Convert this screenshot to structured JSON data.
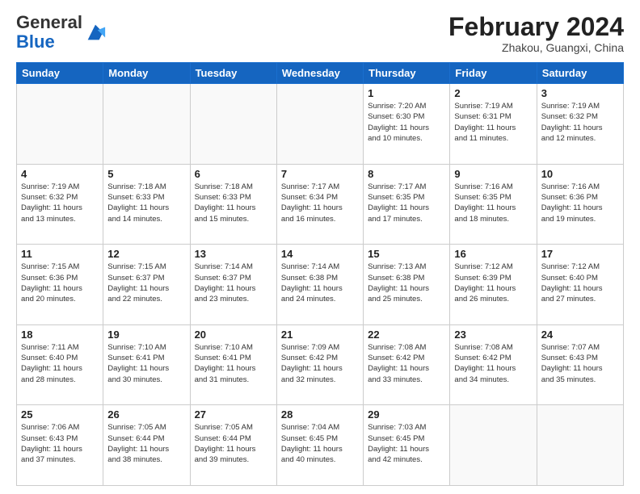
{
  "header": {
    "logo": {
      "general": "General",
      "blue": "Blue"
    },
    "title": "February 2024",
    "subtitle": "Zhakou, Guangxi, China"
  },
  "days_of_week": [
    "Sunday",
    "Monday",
    "Tuesday",
    "Wednesday",
    "Thursday",
    "Friday",
    "Saturday"
  ],
  "weeks": [
    [
      {
        "day": "",
        "info": ""
      },
      {
        "day": "",
        "info": ""
      },
      {
        "day": "",
        "info": ""
      },
      {
        "day": "",
        "info": ""
      },
      {
        "day": "1",
        "info": "Sunrise: 7:20 AM\nSunset: 6:30 PM\nDaylight: 11 hours\nand 10 minutes."
      },
      {
        "day": "2",
        "info": "Sunrise: 7:19 AM\nSunset: 6:31 PM\nDaylight: 11 hours\nand 11 minutes."
      },
      {
        "day": "3",
        "info": "Sunrise: 7:19 AM\nSunset: 6:32 PM\nDaylight: 11 hours\nand 12 minutes."
      }
    ],
    [
      {
        "day": "4",
        "info": "Sunrise: 7:19 AM\nSunset: 6:32 PM\nDaylight: 11 hours\nand 13 minutes."
      },
      {
        "day": "5",
        "info": "Sunrise: 7:18 AM\nSunset: 6:33 PM\nDaylight: 11 hours\nand 14 minutes."
      },
      {
        "day": "6",
        "info": "Sunrise: 7:18 AM\nSunset: 6:33 PM\nDaylight: 11 hours\nand 15 minutes."
      },
      {
        "day": "7",
        "info": "Sunrise: 7:17 AM\nSunset: 6:34 PM\nDaylight: 11 hours\nand 16 minutes."
      },
      {
        "day": "8",
        "info": "Sunrise: 7:17 AM\nSunset: 6:35 PM\nDaylight: 11 hours\nand 17 minutes."
      },
      {
        "day": "9",
        "info": "Sunrise: 7:16 AM\nSunset: 6:35 PM\nDaylight: 11 hours\nand 18 minutes."
      },
      {
        "day": "10",
        "info": "Sunrise: 7:16 AM\nSunset: 6:36 PM\nDaylight: 11 hours\nand 19 minutes."
      }
    ],
    [
      {
        "day": "11",
        "info": "Sunrise: 7:15 AM\nSunset: 6:36 PM\nDaylight: 11 hours\nand 20 minutes."
      },
      {
        "day": "12",
        "info": "Sunrise: 7:15 AM\nSunset: 6:37 PM\nDaylight: 11 hours\nand 22 minutes."
      },
      {
        "day": "13",
        "info": "Sunrise: 7:14 AM\nSunset: 6:37 PM\nDaylight: 11 hours\nand 23 minutes."
      },
      {
        "day": "14",
        "info": "Sunrise: 7:14 AM\nSunset: 6:38 PM\nDaylight: 11 hours\nand 24 minutes."
      },
      {
        "day": "15",
        "info": "Sunrise: 7:13 AM\nSunset: 6:38 PM\nDaylight: 11 hours\nand 25 minutes."
      },
      {
        "day": "16",
        "info": "Sunrise: 7:12 AM\nSunset: 6:39 PM\nDaylight: 11 hours\nand 26 minutes."
      },
      {
        "day": "17",
        "info": "Sunrise: 7:12 AM\nSunset: 6:40 PM\nDaylight: 11 hours\nand 27 minutes."
      }
    ],
    [
      {
        "day": "18",
        "info": "Sunrise: 7:11 AM\nSunset: 6:40 PM\nDaylight: 11 hours\nand 28 minutes."
      },
      {
        "day": "19",
        "info": "Sunrise: 7:10 AM\nSunset: 6:41 PM\nDaylight: 11 hours\nand 30 minutes."
      },
      {
        "day": "20",
        "info": "Sunrise: 7:10 AM\nSunset: 6:41 PM\nDaylight: 11 hours\nand 31 minutes."
      },
      {
        "day": "21",
        "info": "Sunrise: 7:09 AM\nSunset: 6:42 PM\nDaylight: 11 hours\nand 32 minutes."
      },
      {
        "day": "22",
        "info": "Sunrise: 7:08 AM\nSunset: 6:42 PM\nDaylight: 11 hours\nand 33 minutes."
      },
      {
        "day": "23",
        "info": "Sunrise: 7:08 AM\nSunset: 6:42 PM\nDaylight: 11 hours\nand 34 minutes."
      },
      {
        "day": "24",
        "info": "Sunrise: 7:07 AM\nSunset: 6:43 PM\nDaylight: 11 hours\nand 35 minutes."
      }
    ],
    [
      {
        "day": "25",
        "info": "Sunrise: 7:06 AM\nSunset: 6:43 PM\nDaylight: 11 hours\nand 37 minutes."
      },
      {
        "day": "26",
        "info": "Sunrise: 7:05 AM\nSunset: 6:44 PM\nDaylight: 11 hours\nand 38 minutes."
      },
      {
        "day": "27",
        "info": "Sunrise: 7:05 AM\nSunset: 6:44 PM\nDaylight: 11 hours\nand 39 minutes."
      },
      {
        "day": "28",
        "info": "Sunrise: 7:04 AM\nSunset: 6:45 PM\nDaylight: 11 hours\nand 40 minutes."
      },
      {
        "day": "29",
        "info": "Sunrise: 7:03 AM\nSunset: 6:45 PM\nDaylight: 11 hours\nand 42 minutes."
      },
      {
        "day": "",
        "info": ""
      },
      {
        "day": "",
        "info": ""
      }
    ]
  ]
}
